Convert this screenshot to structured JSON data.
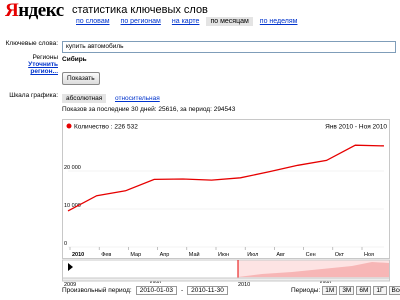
{
  "header": {
    "logo_first": "Я",
    "logo_rest": "ндекс",
    "title": "статистика ключевых слов"
  },
  "tabs": [
    {
      "label": "по словам",
      "active": false
    },
    {
      "label": "по регионам",
      "active": false
    },
    {
      "label": "на карте",
      "active": false
    },
    {
      "label": "по месяцам",
      "active": true
    },
    {
      "label": "по неделям",
      "active": false
    }
  ],
  "form": {
    "keywords_label": "Ключевые слова:",
    "keyword_value": "купить автомобиль",
    "regions_label": "Регионы",
    "regions_link": "Уточнить регион...",
    "region_value": "Сибирь",
    "show_button": "Показать",
    "scale_label": "Шкала графика:",
    "scale_absolute": "абсолютная",
    "scale_relative": "относительная"
  },
  "summary": {
    "shows_text": "Показов за последние 30 дней:  25616, за период:  294543"
  },
  "chart_data": {
    "type": "line",
    "legend": "Количество : 226 532",
    "range_label": "Янв 2010 - Ноя 2010",
    "categories": [
      "2010",
      "Фев",
      "Мар",
      "Апр",
      "Май",
      "Июн",
      "Июл",
      "Авг",
      "Сен",
      "Окт",
      "Ноя"
    ],
    "values": [
      9500,
      13500,
      14800,
      17800,
      17900,
      17600,
      18200,
      19800,
      21500,
      22800,
      26800,
      26600
    ],
    "yticks": [
      "0",
      "10 000",
      "20 000"
    ],
    "ylim": [
      0,
      30000
    ],
    "line_color": "#e60000",
    "navigator_labels": [
      "2009",
      "Июл",
      "2010",
      "Июл"
    ]
  },
  "footer": {
    "period_label": "Произвольный период:",
    "date_from": "2010-01-03",
    "date_to": "2010-11-30",
    "periods_label": "Периоды:",
    "period_buttons": [
      "1М",
      "3М",
      "6М",
      "1Г",
      "Всё"
    ]
  }
}
